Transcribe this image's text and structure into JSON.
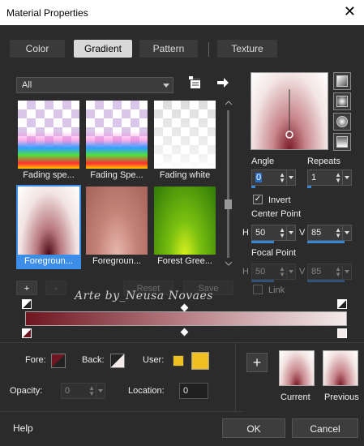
{
  "window": {
    "title": "Material Properties",
    "close": "✕"
  },
  "tabs": [
    {
      "label": "Color"
    },
    {
      "label": "Gradient"
    },
    {
      "label": "Pattern"
    },
    {
      "label": "Texture"
    }
  ],
  "category": {
    "value": "All"
  },
  "gradients": [
    {
      "label": "Fading spe..."
    },
    {
      "label": "Fading Spe..."
    },
    {
      "label": "Fading white"
    },
    {
      "label": "Foregroun..."
    },
    {
      "label": "Foregroun..."
    },
    {
      "label": "Forest Gree..."
    }
  ],
  "angle": {
    "label": "Angle",
    "value": "0"
  },
  "repeats": {
    "label": "Repeats",
    "value": "1"
  },
  "invert": {
    "label": "Invert",
    "checked": true
  },
  "center_point": {
    "label": "Center Point",
    "h_label": "H",
    "h": "50",
    "v_label": "V",
    "v": "85"
  },
  "focal_point": {
    "label": "Focal Point",
    "h_label": "H",
    "h": "50",
    "v_label": "V",
    "v": "85"
  },
  "link": {
    "label": "Link"
  },
  "editor": {
    "add": "+",
    "remove": "-",
    "reset": "Reset",
    "save": "Save"
  },
  "watermark": "Arte by_Neusa Novaes",
  "fore": {
    "label": "Fore:",
    "color": "#6e1622"
  },
  "back": {
    "label": "Back:"
  },
  "user": {
    "label": "User:",
    "color": "#f0c020"
  },
  "opacity": {
    "label": "Opacity:",
    "value": "0"
  },
  "location": {
    "label": "Location:",
    "value": "0"
  },
  "add_button": "+",
  "current": {
    "label": "Current"
  },
  "previous": {
    "label": "Previous"
  },
  "help": "Help",
  "ok": "OK",
  "cancel": "Cancel"
}
